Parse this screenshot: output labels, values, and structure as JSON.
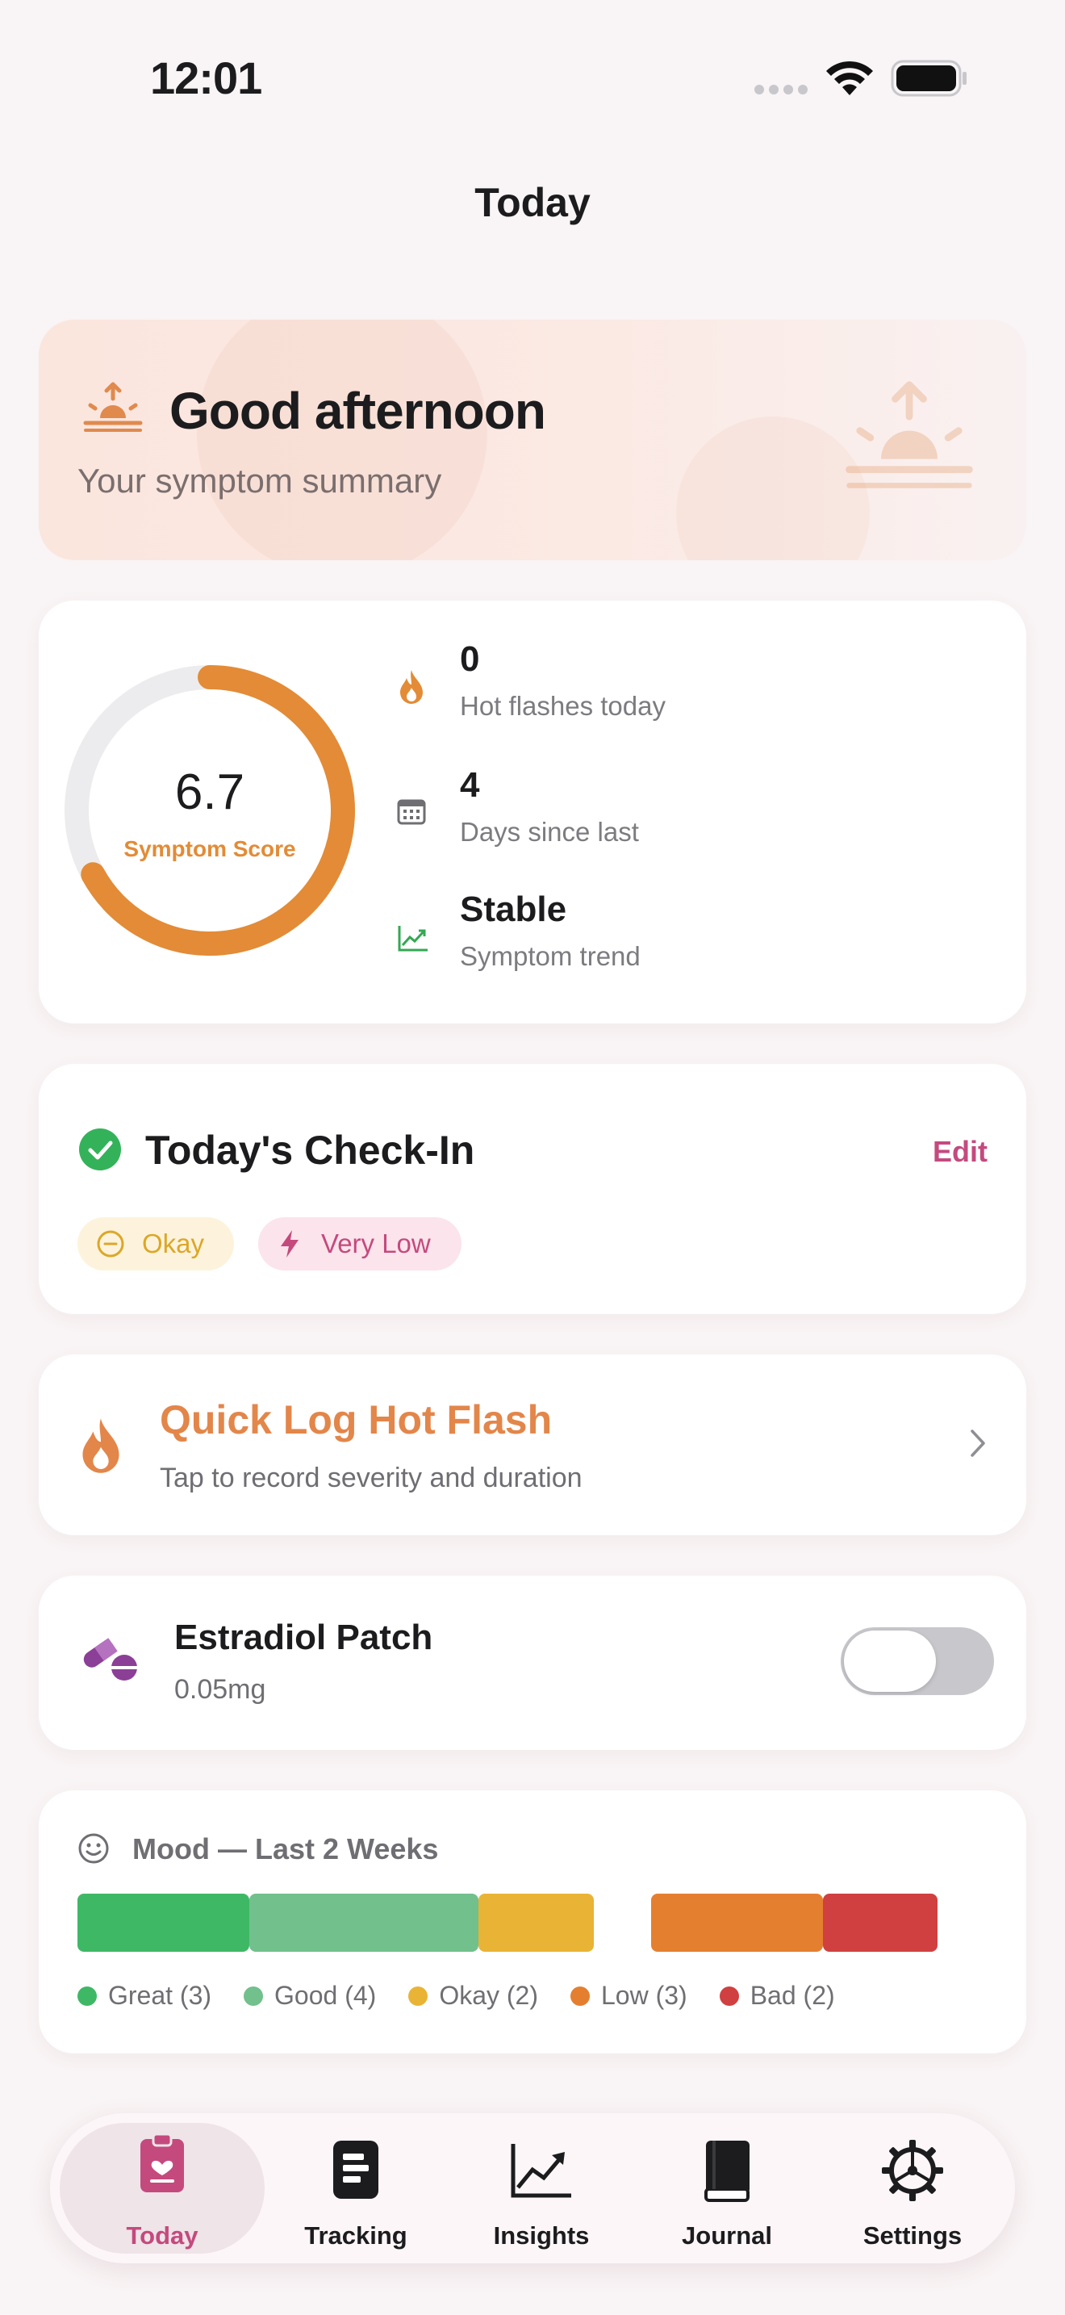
{
  "status_bar": {
    "time": "12:01"
  },
  "nav": {
    "title": "Today"
  },
  "greeting": {
    "title": "Good afternoon",
    "subtitle": "Your symptom summary"
  },
  "score_card": {
    "score": "6.7",
    "score_label": "Symptom Score",
    "ring_fraction": 0.67,
    "stats": [
      {
        "value": "0",
        "label": "Hot flashes today",
        "icon": "flame-icon"
      },
      {
        "value": "4",
        "label": "Days since last",
        "icon": "calendar-icon"
      },
      {
        "value": "Stable",
        "label": "Symptom trend",
        "icon": "trend-chart-icon"
      }
    ]
  },
  "checkin": {
    "title": "Today's Check-In",
    "edit_label": "Edit",
    "mood_pill": "Okay",
    "energy_pill": "Very Low"
  },
  "quick_log": {
    "title": "Quick Log Hot Flash",
    "subtitle": "Tap to record severity and duration"
  },
  "medication": {
    "name": "Estradiol Patch",
    "dose": "0.05mg",
    "taken": false
  },
  "mood": {
    "title": "Mood — Last 2 Weeks",
    "segments": [
      {
        "key": "great",
        "count": 3,
        "color": "#3fb866"
      },
      {
        "key": "good",
        "count": 4,
        "color": "#72c08c"
      },
      {
        "key": "okay",
        "count": 2,
        "color": "#e9b435"
      },
      {
        "key": "gap",
        "count": 1,
        "color": "transparent"
      },
      {
        "key": "low",
        "count": 3,
        "color": "#e57f30"
      },
      {
        "key": "bad",
        "count": 2,
        "color": "#d04040"
      }
    ],
    "legend": [
      {
        "label": "Great (3)",
        "color": "#3fb866"
      },
      {
        "label": "Good (4)",
        "color": "#72c08c"
      },
      {
        "label": "Okay (2)",
        "color": "#e9b435"
      },
      {
        "label": "Low (3)",
        "color": "#e57f30"
      },
      {
        "label": "Bad (2)",
        "color": "#d04040"
      }
    ]
  },
  "tabs": [
    {
      "label": "Today",
      "icon": "clipboard-heart-icon",
      "active": true
    },
    {
      "label": "Tracking",
      "icon": "list-icon",
      "active": false
    },
    {
      "label": "Insights",
      "icon": "chart-icon",
      "active": false
    },
    {
      "label": "Journal",
      "icon": "book-icon",
      "active": false
    },
    {
      "label": "Settings",
      "icon": "gear-icon",
      "active": false
    }
  ],
  "colors": {
    "accent": "#c44a7e",
    "orange": "#e38b36",
    "green": "#34a853",
    "background": "#f9f4f5"
  }
}
